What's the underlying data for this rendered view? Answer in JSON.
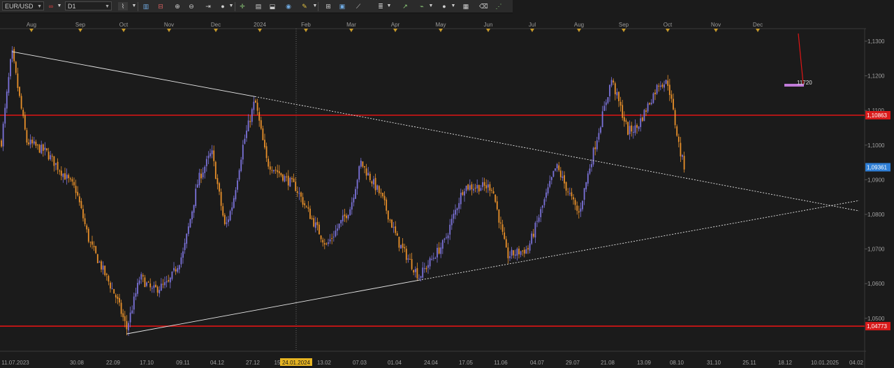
{
  "toolbar": {
    "symbol": "EUR/USD",
    "timeframe": "D1",
    "icons": [
      "chart-type-icon",
      "bar-chart-icon",
      "line-indicator-icon",
      "zoom-in-icon",
      "zoom-out-icon",
      "shift-chart-icon",
      "autoscroll-icon",
      "crosshair-icon",
      "text-tool-icon",
      "channel-icon",
      "vertical-line-icon",
      "globe-icon",
      "pencil-icon",
      "horizontal-line-icon",
      "rectangle-icon",
      "trendline-icon",
      "fibonacci-icon",
      "arrow-tool-icon",
      "ellipse-icon",
      "template-icon",
      "eraser-icon",
      "more-icon"
    ]
  },
  "chart_data": {
    "type": "candlestick",
    "symbol": "EUR/USD",
    "timeframe": "D1",
    "y_ticks": [
      "1,1300",
      "1,1200",
      "1,1100",
      "1,1000",
      "1,0900",
      "1,0800",
      "1,0700",
      "1,0600",
      "1,0500"
    ],
    "ylim": [
      1.0425,
      1.1335
    ],
    "month_labels": [
      "Aug",
      "Sep",
      "Oct",
      "Nov",
      "Dec",
      "2024",
      "Feb",
      "Mar",
      "Apr",
      "May",
      "Jun",
      "Jul",
      "Aug",
      "Sep",
      "Oct",
      "Nov",
      "Dec"
    ],
    "date_labels": [
      "11.07.2023",
      "30.08",
      "22.09",
      "17.10",
      "09.11",
      "04.12",
      "27.12",
      "15",
      "13.02",
      "07.03",
      "01.04",
      "24.04",
      "17.05",
      "11.06",
      "04.07",
      "29.07",
      "21.08",
      "13.09",
      "08.10",
      "31.10",
      "25.11",
      "18.12",
      "10.01.2025",
      "04.02"
    ],
    "crosshair_date": "24.01.2024",
    "price_labels": [
      {
        "value": 1.10863,
        "text": "1,10863",
        "color": "#d81b1b"
      },
      {
        "value": 1.09361,
        "text": "1,09361",
        "color": "#2f7fd6"
      },
      {
        "value": 1.04773,
        "text": "1,04773",
        "color": "#d81b1b"
      }
    ],
    "horizontal_lines": [
      1.10863,
      1.04773
    ],
    "annotation": {
      "text": "11720",
      "color": "#c07ad8"
    },
    "grid": false,
    "series": [
      {
        "name": "EUR/USD D1",
        "segments": [
          {
            "date": "2023-07-11",
            "price": 1.101
          },
          {
            "date": "2023-07-18",
            "price": 1.127
          },
          {
            "date": "2023-07-28",
            "price": 1.101
          },
          {
            "date": "2023-08-10",
            "price": 1.098
          },
          {
            "date": "2023-08-30",
            "price": 1.087
          },
          {
            "date": "2023-09-08",
            "price": 1.072
          },
          {
            "date": "2023-09-26",
            "price": 1.056
          },
          {
            "date": "2023-10-03",
            "price": 1.047
          },
          {
            "date": "2023-10-12",
            "price": 1.062
          },
          {
            "date": "2023-10-20",
            "price": 1.058
          },
          {
            "date": "2023-10-31",
            "price": 1.06
          },
          {
            "date": "2023-11-10",
            "price": 1.069
          },
          {
            "date": "2023-11-20",
            "price": 1.09
          },
          {
            "date": "2023-11-29",
            "price": 1.098
          },
          {
            "date": "2023-12-08",
            "price": 1.076
          },
          {
            "date": "2023-12-13",
            "price": 1.083
          },
          {
            "date": "2023-12-20",
            "price": 1.1
          },
          {
            "date": "2023-12-28",
            "price": 1.113
          },
          {
            "date": "2024-01-05",
            "price": 1.095
          },
          {
            "date": "2024-01-24",
            "price": 1.088
          },
          {
            "date": "2024-02-05",
            "price": 1.078
          },
          {
            "date": "2024-02-14",
            "price": 1.071
          },
          {
            "date": "2024-03-01",
            "price": 1.082
          },
          {
            "date": "2024-03-08",
            "price": 1.095
          },
          {
            "date": "2024-03-22",
            "price": 1.085
          },
          {
            "date": "2024-04-02",
            "price": 1.072
          },
          {
            "date": "2024-04-16",
            "price": 1.062
          },
          {
            "date": "2024-05-03",
            "price": 1.072
          },
          {
            "date": "2024-05-16",
            "price": 1.088
          },
          {
            "date": "2024-06-04",
            "price": 1.088
          },
          {
            "date": "2024-06-14",
            "price": 1.068
          },
          {
            "date": "2024-06-28",
            "price": 1.07
          },
          {
            "date": "2024-07-17",
            "price": 1.094
          },
          {
            "date": "2024-08-01",
            "price": 1.08
          },
          {
            "date": "2024-08-08",
            "price": 1.093
          },
          {
            "date": "2024-08-23",
            "price": 1.119
          },
          {
            "date": "2024-09-03",
            "price": 1.104
          },
          {
            "date": "2024-09-09",
            "price": 1.105
          },
          {
            "date": "2024-09-24",
            "price": 1.118
          },
          {
            "date": "2024-09-30",
            "price": 1.118
          },
          {
            "date": "2024-10-08",
            "price": 1.098
          },
          {
            "date": "2024-10-11",
            "price": 1.0936
          }
        ]
      }
    ],
    "trendlines": [
      {
        "from": {
          "date": "2023-07-18",
          "price": 1.127
        },
        "to": {
          "date": "2023-12-28",
          "price": 1.114
        },
        "style": "solid"
      },
      {
        "from": {
          "date": "2023-12-28",
          "price": 1.114
        },
        "to": {
          "date": "2025-02-05",
          "price": 1.081
        },
        "style": "dotted"
      },
      {
        "from": {
          "date": "2023-10-03",
          "price": 1.0455
        },
        "to": {
          "date": "2024-04-16",
          "price": 1.061
        },
        "style": "solid"
      },
      {
        "from": {
          "date": "2024-04-16",
          "price": 1.061
        },
        "to": {
          "date": "2025-02-05",
          "price": 1.084
        },
        "style": "dotted"
      }
    ]
  }
}
